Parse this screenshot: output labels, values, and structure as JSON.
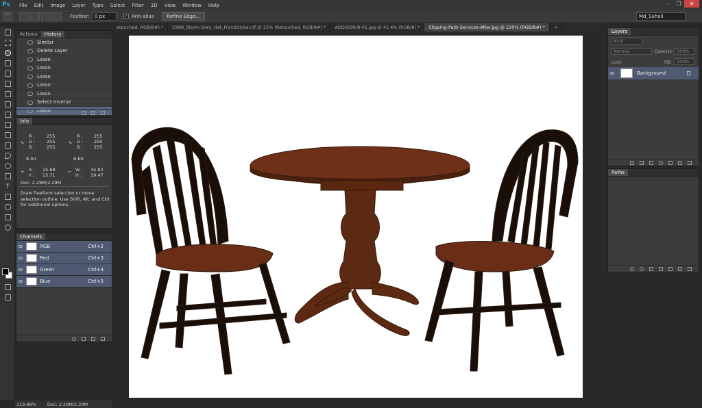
{
  "menubar": {
    "logo": "Ps",
    "items": [
      "File",
      "Edit",
      "Image",
      "Layer",
      "Type",
      "Select",
      "Filter",
      "3D",
      "View",
      "Window",
      "Help"
    ],
    "controls": [
      "–",
      "❐",
      "✕"
    ]
  },
  "options": {
    "feather_label": "Feather:",
    "feather_value": "0 px",
    "antialias_label": "Anti-alias",
    "antialias_checked": true,
    "refine_edge": "Refine Edge...",
    "workspace": "Md_Suhail"
  },
  "doc_tabs": [
    {
      "label": "etouched, RGB/8#) *",
      "active": false
    },
    {
      "label": "C988_Storm Grey_Hat_FrontSticker.tif @ 32% (Retouched, RGB/8#) *",
      "active": false
    },
    {
      "label": "ADDISON-B-01.jpg @ 41.4% (RGB/8) *",
      "active": false
    },
    {
      "label": "Clipping-Path-Services-After.jpg @ 120% (RGB/8#) *",
      "active": true
    }
  ],
  "history_panel": {
    "tabs": [
      "Actions",
      "History"
    ],
    "active_tab": "History",
    "items": [
      "Similar",
      "Delete Layer",
      "Lasso",
      "Lasso",
      "Lasso",
      "Lasso",
      "Lasso",
      "Select Inverse",
      "Lasso"
    ],
    "selected_index": 8
  },
  "info_panel": {
    "title": "Info",
    "r_label": "R :",
    "g_label": "G :",
    "b_label": "B :",
    "r1": "255",
    "g1": "255",
    "b1": "255",
    "r2": "255",
    "g2": "255",
    "b2": "255",
    "bitdepth1": "8-bit",
    "bitdepth2": "8-bit",
    "x_label": "X :",
    "y_label": "Y :",
    "x": "15.68",
    "y": "15.71",
    "w_label": "W :",
    "h_label": "H :",
    "w": "34.82",
    "h": "19.47",
    "doc": "Doc: 2.29M/2.29M",
    "hint": "Draw freeform selection or move\nselection outline.  Use Shift, Alt, and Ctrl\nfor additional options."
  },
  "channels_panel": {
    "title": "Channels",
    "rows": [
      {
        "name": "RGB",
        "shortcut": "Ctrl+2"
      },
      {
        "name": "Red",
        "shortcut": "Ctrl+3"
      },
      {
        "name": "Green",
        "shortcut": "Ctrl+4"
      },
      {
        "name": "Blue",
        "shortcut": "Ctrl+5"
      }
    ]
  },
  "layers_panel": {
    "title": "Layers",
    "kind": "Kind",
    "blend": "Normal",
    "opacity_label": "Opacity:",
    "opacity": "100%",
    "lock_label": "Lock:",
    "fill_label": "Fill:",
    "fill": "100%",
    "layer_name": "Background"
  },
  "paths_panel": {
    "title": "Paths"
  },
  "status": {
    "zoom": "119.88%",
    "doc": "Doc: 2.29M/2.29M"
  },
  "colors": {
    "selection": "#5a6680",
    "chair": "#1a0e08",
    "wood": "#7a3a1e",
    "wood_dark": "#4a200f"
  }
}
